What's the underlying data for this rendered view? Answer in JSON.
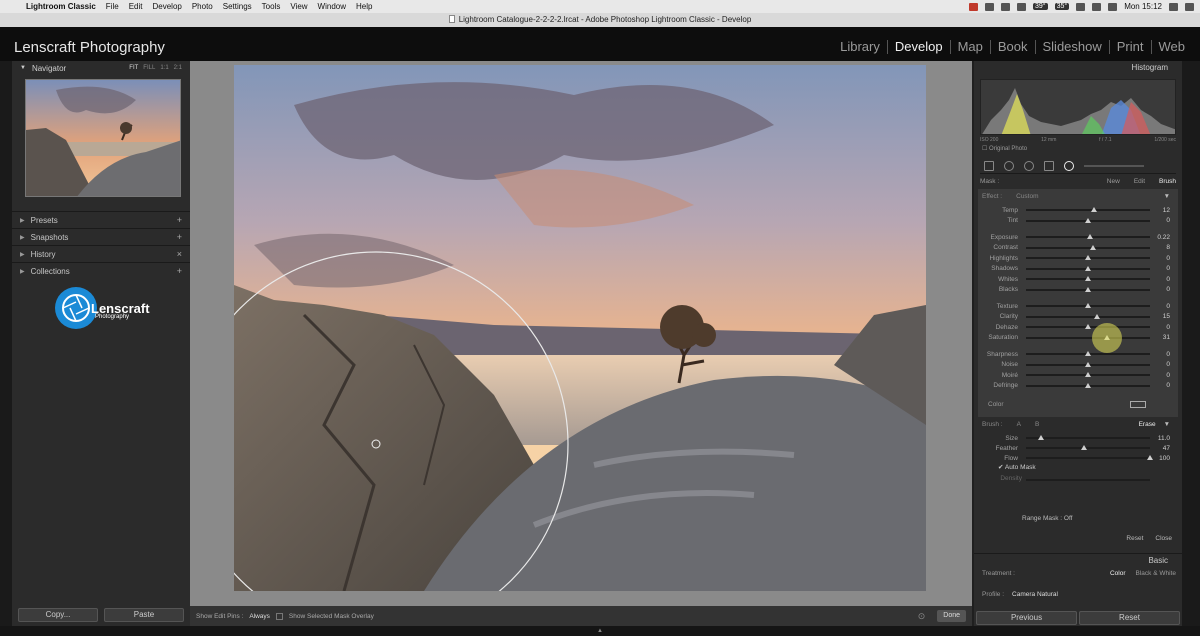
{
  "menubar": {
    "app_name": "Lightroom Classic",
    "items": [
      "File",
      "Edit",
      "Develop",
      "Photo",
      "Settings",
      "Tools",
      "View",
      "Window",
      "Help"
    ],
    "temp1": "39°",
    "temp2": "35°",
    "clock": "Mon 15:12"
  },
  "window": {
    "title": "Lightroom Catalogue-2-2-2-2.lrcat - Adobe Photoshop Lightroom Classic - Develop"
  },
  "identity": {
    "brand": "Lenscraft Photography"
  },
  "modules": [
    "Library",
    "Develop",
    "Map",
    "Book",
    "Slideshow",
    "Print",
    "Web"
  ],
  "left_panel": {
    "navigator": "Navigator",
    "zoom_fit": "FIT",
    "zoom_fill": "FILL",
    "zoom_1": "1:1",
    "zoom_2": "2:1",
    "rows": [
      {
        "label": "Presets",
        "action": "+"
      },
      {
        "label": "Snapshots",
        "action": "+"
      },
      {
        "label": "History",
        "action": "×"
      },
      {
        "label": "Collections",
        "action": "+"
      }
    ],
    "logo_text": "enscraft",
    "logo_letter": "L",
    "logo_sub": "Photography",
    "copy_label": "Copy...",
    "paste_label": "Paste"
  },
  "toolbar": {
    "edit_pins_label": "Show Edit Pins :",
    "edit_pins_value": "Always",
    "mask_overlay_label": "Show Selected Mask Overlay",
    "done_label": "Done"
  },
  "right_panel": {
    "histogram": "Histogram",
    "iso": "ISO 200",
    "focal": "12 mm",
    "aperture": "f / 7.1",
    "shutter": "1/200 sec",
    "original_photo": "Original Photo",
    "mask_label": "Mask :",
    "mask_new": "New",
    "mask_edit": "Edit",
    "mask_brush": "Brush",
    "effect_label": "Effect :",
    "effect_value": "Custom",
    "sliders": [
      {
        "name": "Temp",
        "value": "12",
        "pos": 0.55
      },
      {
        "name": "Tint",
        "value": "0",
        "pos": 0.5
      },
      {
        "name": "Exposure",
        "value": "0.22",
        "pos": 0.52
      },
      {
        "name": "Contrast",
        "value": "8",
        "pos": 0.54
      },
      {
        "name": "Highlights",
        "value": "0",
        "pos": 0.5
      },
      {
        "name": "Shadows",
        "value": "0",
        "pos": 0.5
      },
      {
        "name": "Whites",
        "value": "0",
        "pos": 0.5
      },
      {
        "name": "Blacks",
        "value": "0",
        "pos": 0.5
      },
      {
        "name": "Texture",
        "value": "0",
        "pos": 0.5
      },
      {
        "name": "Clarity",
        "value": "15",
        "pos": 0.57
      },
      {
        "name": "Dehaze",
        "value": "0",
        "pos": 0.5
      },
      {
        "name": "Saturation",
        "value": "31",
        "pos": 0.65
      },
      {
        "name": "Sharpness",
        "value": "0",
        "pos": 0.5
      },
      {
        "name": "Noise",
        "value": "0",
        "pos": 0.5
      },
      {
        "name": "Moiré",
        "value": "0",
        "pos": 0.5
      },
      {
        "name": "Defringe",
        "value": "0",
        "pos": 0.5
      }
    ],
    "color_label": "Color",
    "brush_label": "Brush :",
    "brush_a": "A",
    "brush_b": "B",
    "brush_erase": "Erase",
    "brush_sliders": [
      {
        "name": "Size",
        "value": "11.0",
        "pos": 0.12
      },
      {
        "name": "Feather",
        "value": "47",
        "pos": 0.47
      },
      {
        "name": "Flow",
        "value": "100",
        "pos": 1.0
      }
    ],
    "auto_mask": "Auto Mask",
    "density": "Density",
    "range_mask": "Range Mask : Off",
    "reset": "Reset",
    "close": "Close",
    "basic": "Basic",
    "treatment_label": "Treatment :",
    "treatment_color": "Color",
    "treatment_bw": "Black & White",
    "profile_label": "Profile :",
    "profile_value": "Camera Natural",
    "previous_label": "Previous",
    "reset_label": "Reset"
  },
  "colors": {
    "accent_blue": "#1b8ad6",
    "panel": "#2b2b2b",
    "cursor_highlight": "#e6e35a"
  }
}
